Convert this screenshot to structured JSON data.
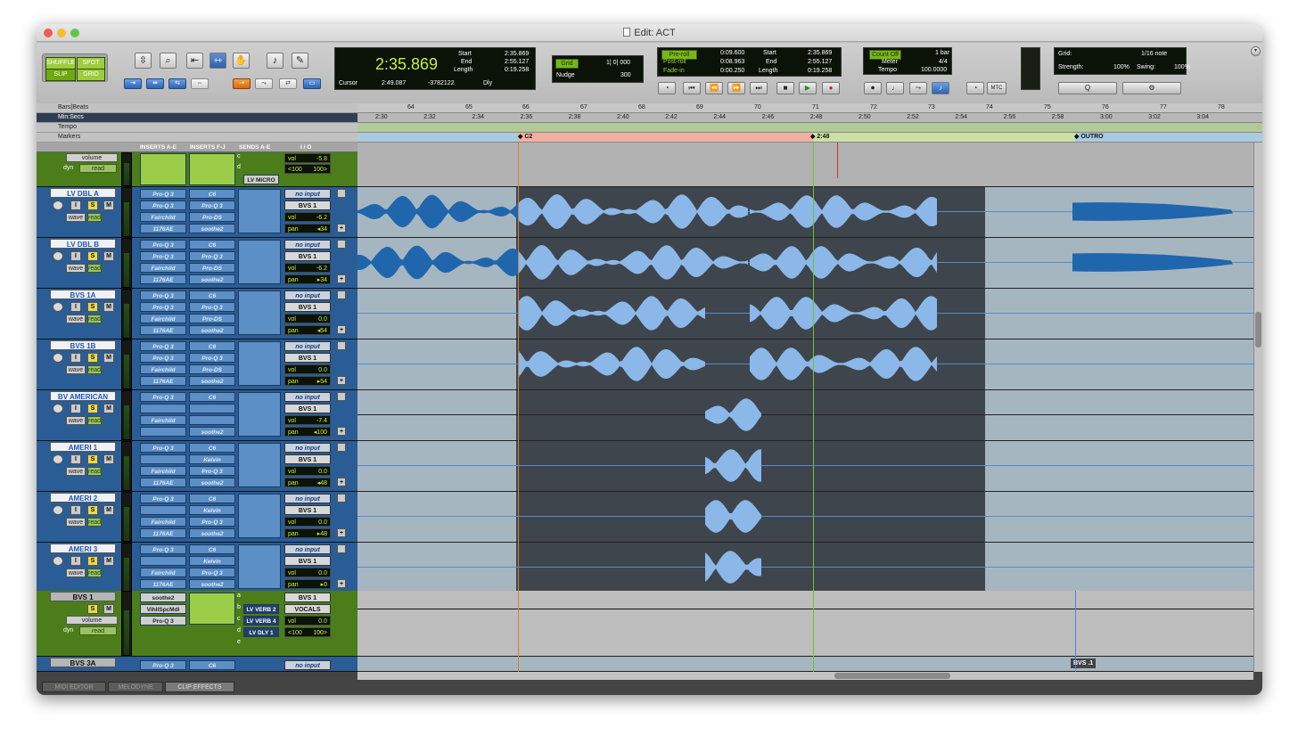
{
  "window": {
    "title": "Edit: ACT"
  },
  "edit_modes": {
    "shuffle": "SHUFFLE",
    "spot": "SPOT",
    "slip": "SLIP",
    "grid": "GRID"
  },
  "counter": {
    "main": "2:35.869",
    "start_label": "Start",
    "start": "2:35.869",
    "end_label": "End",
    "end": "2:55.127",
    "length_label": "Length",
    "length": "0:19.258",
    "cursor_label": "Cursor",
    "cursor": "2:49.087",
    "sample": "-3782122",
    "dly": "Dly"
  },
  "grid_nudge": {
    "grid_label": "Grid",
    "grid_value": "1| 0| 000",
    "nudge_label": "Nudge",
    "nudge_value": "300"
  },
  "transport_counter": {
    "preroll": "Pre-roll",
    "preroll_v": "0:09.600",
    "postroll": "Post-roll",
    "postroll_v": "0:08.963",
    "fadein": "Fade-in",
    "fadein_v": "0:00.250",
    "start_label": "Start",
    "start": "2:35.869",
    "end_label": "End",
    "end": "2:55.127",
    "length_label": "Length",
    "length": "0:19.258"
  },
  "meter_panel": {
    "countoff": "Count Off",
    "countoff_v": "1 bar",
    "meter_label": "Meter",
    "meter": "4/4",
    "tempo_label": "Tempo",
    "tempo": "100.0000",
    "mtc": "MTC"
  },
  "grid_panel": {
    "grid_label": "Grid:",
    "grid_value": "1/16 note",
    "strength_label": "Strength:",
    "strength": "100%",
    "swing_label": "Swing:",
    "swing": "100%",
    "q_label": "Q"
  },
  "rulers": {
    "bars": "Bars|Beats",
    "minsecs": "Min:Secs",
    "tempo": "Tempo",
    "markers": "Markers",
    "bar_ticks": [
      "64",
      "65",
      "66",
      "67",
      "68",
      "69",
      "70",
      "71",
      "72",
      "73",
      "74",
      "75",
      "76",
      "77",
      "78"
    ],
    "time_ticks": [
      "2:30",
      "2:32",
      "2:34",
      "2:36",
      "2:38",
      "2:40",
      "2:42",
      "2:44",
      "2:46",
      "2:48",
      "2:50",
      "2:52",
      "2:54",
      "2:56",
      "2:58",
      "3:00",
      "3:02",
      "3:04"
    ],
    "marker_names": [
      "C2",
      "2:48",
      "OUTRO"
    ]
  },
  "columns": {
    "inserts_ae": "INSERTS A-E",
    "inserts_fj": "INSERTS F-J",
    "sends_ae": "SENDS A-E",
    "io": "I / O"
  },
  "top_track": {
    "mode": "volume",
    "dyn": "dyn",
    "auto": "read",
    "vol": "-5.8",
    "pan_l": "<100",
    "pan_r": "100>",
    "send": "LV MICRO",
    "send_letters": [
      "c",
      "d",
      "e"
    ]
  },
  "tracks": [
    {
      "name": "LV DBL A",
      "ins1": [
        "Pro-Q 3",
        "Pro-Q 3",
        "Fairchild",
        "1176AE"
      ],
      "ins2": [
        "C6",
        "Pro-Q 3",
        "Pro-DS",
        "soothe2"
      ],
      "input": "no input",
      "output": "BVS 1",
      "vol": "-6.2",
      "pan": "34",
      "pan_dir": "◂",
      "mode": "wave",
      "auto": "read"
    },
    {
      "name": "LV DBL B",
      "ins1": [
        "Pro-Q 3",
        "Pro-Q 3",
        "Fairchild",
        "1176AE"
      ],
      "ins2": [
        "C6",
        "Pro-Q 3",
        "Pro-DS",
        "soothe2"
      ],
      "input": "no input",
      "output": "BVS 1",
      "vol": "-6.2",
      "pan": "34",
      "pan_dir": "▸",
      "mode": "wave",
      "auto": "read"
    },
    {
      "name": "BVS 1A",
      "ins1": [
        "Pro-Q 3",
        "Pro-Q 3",
        "Fairchild",
        "1176AE"
      ],
      "ins2": [
        "C6",
        "Pro-Q 3",
        "Pro-DS",
        "soothe2"
      ],
      "input": "no input",
      "output": "BVS 1",
      "vol": "0.0",
      "pan": "54",
      "pan_dir": "◂",
      "mode": "wave",
      "auto": "read"
    },
    {
      "name": "BVS 1B",
      "ins1": [
        "Pro-Q 3",
        "Pro-Q 3",
        "Fairchild",
        "1176AE"
      ],
      "ins2": [
        "C6",
        "Pro-Q 3",
        "Pro-DS",
        "soothe2"
      ],
      "input": "no input",
      "output": "BVS 1",
      "vol": "0.0",
      "pan": "54",
      "pan_dir": "▸",
      "mode": "wave",
      "auto": "read"
    },
    {
      "name": "BV AMERICAN",
      "ins1": [
        "Pro-Q 3",
        "",
        "Fairchild",
        ""
      ],
      "ins2": [
        "C6",
        "",
        "",
        "soothe2"
      ],
      "input": "no input",
      "output": "BVS 1",
      "vol": "-7.4",
      "pan": "100",
      "pan_dir": "◂",
      "mode": "wave",
      "auto": "read"
    },
    {
      "name": "AMERI 1",
      "ins1": [
        "Pro-Q 3",
        "",
        "Fairchild",
        "1176AE"
      ],
      "ins2": [
        "C6",
        "Kelvin",
        "Pro-Q 3",
        "soothe2"
      ],
      "input": "no input",
      "output": "BVS 1",
      "vol": "0.0",
      "pan": "48",
      "pan_dir": "◂",
      "mode": "wave",
      "auto": "read"
    },
    {
      "name": "AMERI 2",
      "ins1": [
        "Pro-Q 3",
        "",
        "Fairchild",
        "1176AE"
      ],
      "ins2": [
        "C6",
        "Kelvin",
        "Pro-Q 3",
        "soothe2"
      ],
      "input": "no input",
      "output": "BVS 1",
      "vol": "0.0",
      "pan": "48",
      "pan_dir": "▸",
      "mode": "wave",
      "auto": "read"
    },
    {
      "name": "AMERI 3",
      "ins1": [
        "Pro-Q 3",
        "",
        "Fairchild",
        "1176AE"
      ],
      "ins2": [
        "C6",
        "Kelvin",
        "Pro-Q 3",
        "soothe2"
      ],
      "input": "no input",
      "output": "BVS 1",
      "vol": "0.0",
      "pan": "0",
      "pan_dir": "▸",
      "mode": "wave",
      "auto": "read"
    }
  ],
  "aux_track": {
    "name": "BVS 1",
    "ins1": [
      "soothe2",
      "VihIlSpcMdl",
      "Pro-Q 3"
    ],
    "sends": [
      "LV VERB 2",
      "LV VERB 4",
      "LV DLY 1"
    ],
    "send_letters": [
      "a",
      "b",
      "c",
      "d",
      "e"
    ],
    "input": "BVS 1",
    "output": "VOCALS",
    "vol": "0.0",
    "pan_l": "<100",
    "pan_r": "100>",
    "mode": "volume",
    "dyn": "dyn",
    "auto": "read"
  },
  "last_track": {
    "name": "BVS 3A",
    "ins1": "Pro-Q 3",
    "ins2": "C6",
    "input": "no input"
  },
  "clip_label": "BVS .1",
  "bottom_tabs": [
    "MIDI EDITOR",
    "MELODYNE",
    "CLIP EFFECTS"
  ],
  "colors": {
    "track_blue": "#2a5d96",
    "aux_green": "#4b7e1a",
    "waveform": "#8bb8e8",
    "waveform_dark": "#1f66ad",
    "lcd_green": "#c6f03c"
  }
}
